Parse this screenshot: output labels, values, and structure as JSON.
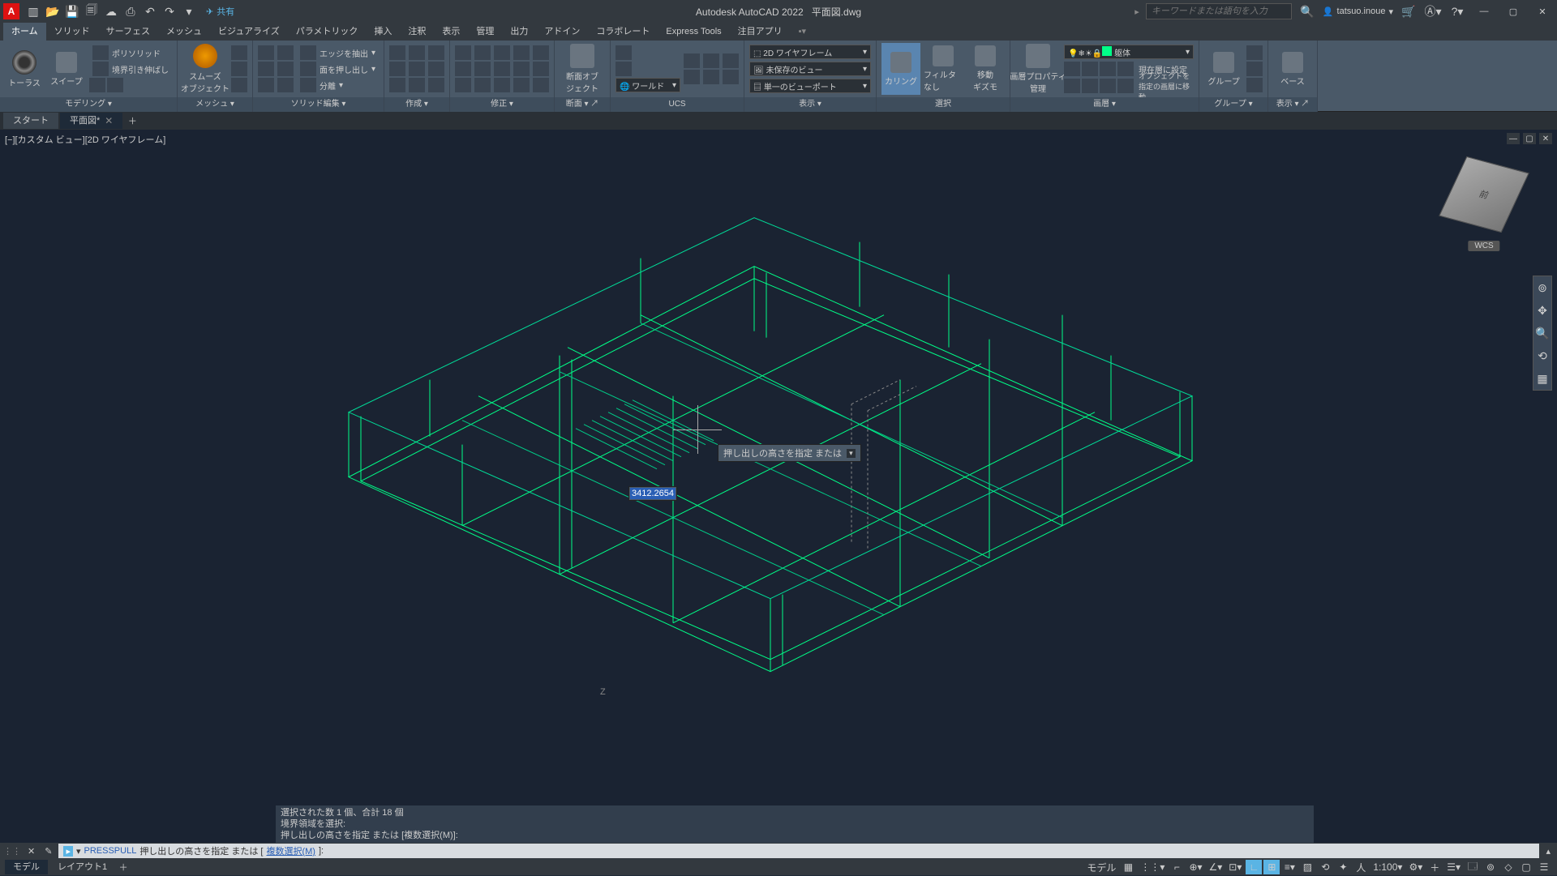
{
  "app": {
    "title_product": "Autodesk AutoCAD 2022",
    "title_file": "平面図.dwg",
    "logo_letter": "A",
    "share": "共有",
    "search_placeholder": "キーワードまたは語句を入力",
    "user": "tatsuo.inoue"
  },
  "tabs": [
    "ホーム",
    "ソリッド",
    "サーフェス",
    "メッシュ",
    "ビジュアライズ",
    "パラメトリック",
    "挿入",
    "注釈",
    "表示",
    "管理",
    "出力",
    "アドイン",
    "コラボレート",
    "Express Tools",
    "注目アプリ"
  ],
  "active_tab": "ホーム",
  "panels": {
    "modeling": "モデリング",
    "mesh": "メッシュ",
    "solid_edit": "ソリッド編集",
    "create": "作成",
    "modify": "修正",
    "section": "断面",
    "ucs": "UCS",
    "display": "表示",
    "select": "選択",
    "layer": "画層",
    "group": "グループ",
    "layout": "表示",
    "base": "ベース"
  },
  "buttons": {
    "torus": "トーラス",
    "sweep": "スイープ",
    "polysolid": "ポリソリッド",
    "boundary": "境界引き伸ばし",
    "smooth": "スムーズ\nオブジェクト",
    "extrude_edge": "エッジを抽出",
    "presspull": "面を押し出し",
    "split": "分離",
    "section_obj": "断面オブ\nジェクト",
    "culling": "カリング",
    "filter_none": "フィルタなし",
    "move_gizmo": "移動\nギズモ",
    "layer_prop": "画層プロパティ\n管理",
    "current_layer": "現在層に設定",
    "move_layer": "オブジェクトを指定の画層に移動",
    "group_btn": "グループ"
  },
  "dropdowns": {
    "visual_style": "2D ワイヤフレーム",
    "view": "未保存のビュー",
    "ucs": "ワールド",
    "viewport": "単一のビューポート",
    "layer": "躯体"
  },
  "doc_tabs": {
    "start": "スタート",
    "file": "平面図*",
    "active": "平面図*"
  },
  "viewport": {
    "label": "[−][カスタム ビュー][2D ワイヤフレーム]",
    "wcs": "WCS",
    "z": "Z",
    "viewcube_face": "前"
  },
  "dynamic": {
    "prompt": "押し出しの高さを指定 または",
    "value": "3412.2654",
    "opt": "▾"
  },
  "history": {
    "l1": "選択された数 1 個、合計 18 個",
    "l2": "境界領域を選択:",
    "l3": "押し出しの高さを指定 または [複数選択(M)]:"
  },
  "command": {
    "name": "PRESSPULL",
    "prompt": "押し出しの高さを指定 または [",
    "link": "複数選択(M)",
    "suffix": "]:"
  },
  "status": {
    "model": "モデル",
    "layout1": "レイアウト1",
    "model_right": "モデル",
    "scale": "1:100"
  }
}
